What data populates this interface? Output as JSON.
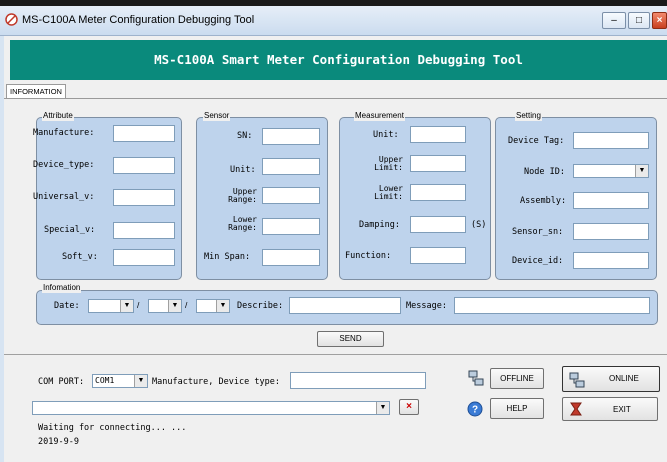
{
  "window": {
    "title": "MS-C100A Meter Configuration Debugging Tool"
  },
  "banner": "MS-C100A Smart Meter Configuration Debugging Tool",
  "tab": "INFORMATION",
  "attribute": {
    "title": "Attribute",
    "labels": [
      "Manufacture:",
      "Device_type:",
      "Universal_v:",
      "Special_v:",
      "Soft_v:"
    ]
  },
  "sensor": {
    "title": "Sensor",
    "sn": "SN:",
    "unit": "Unit:",
    "upper_range": [
      "Upper",
      "Range:"
    ],
    "lower_range": [
      "Lower",
      "Range:"
    ],
    "min_span": "Min Span:"
  },
  "measurement": {
    "title": "Measurement",
    "unit": "Unit:",
    "upper_limit": [
      "Upper",
      "Limit:"
    ],
    "lower_limit": [
      "Lower",
      "Limit:"
    ],
    "damping": "Damping:",
    "damping_unit": "(S)",
    "function": "Function:"
  },
  "setting": {
    "title": "Setting",
    "labels": [
      "Device Tag:",
      "Node ID:",
      "Assembly:",
      "Sensor_sn:",
      "Device_id:"
    ]
  },
  "infomation": {
    "title": "Infomation",
    "date": "Date:",
    "slash": "/",
    "describe": "Describe:",
    "message": "Message:"
  },
  "send_button": "SEND",
  "bottom": {
    "com_port_label": "COM PORT:",
    "com_port_value": "COM1",
    "manufacture_label": "Manufacture, Device type:",
    "clear_mark": "×",
    "status_line1": "Waiting for connecting... ...",
    "status_line2": "2019-9-9",
    "offline": "OFFLINE",
    "online": "ONLINE",
    "help": "HELP",
    "exit": "EXIT"
  },
  "window_controls": {
    "minimize": "–",
    "maximize": "□",
    "close": "×"
  },
  "colors": {
    "banner": "#0a8a7c",
    "group_fill": "#bed3ec",
    "titlebar": "#d7e4f2"
  }
}
